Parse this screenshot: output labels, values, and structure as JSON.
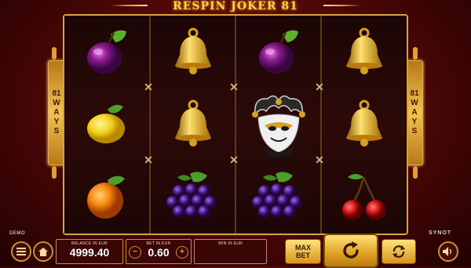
{
  "game": {
    "title": "RESPIN JOKER 81",
    "ways_number": "81",
    "ways_letters": [
      "W",
      "A",
      "Y",
      "S"
    ],
    "demo_label": "DEMO",
    "provider": "SYNOT"
  },
  "reels": [
    [
      "plum",
      "lemon",
      "orange"
    ],
    [
      "bell",
      "bell",
      "grapes"
    ],
    [
      "plum",
      "joker",
      "grapes"
    ],
    [
      "bell",
      "bell",
      "cherries"
    ]
  ],
  "hud": {
    "balance_label": "BALANCE IN EUR",
    "balance_value": "4999.40",
    "bet_label": "BET IN EUR",
    "bet_value": "0.60",
    "minus": "−",
    "plus": "+",
    "win_label": "WIN IN EUR",
    "win_value": "",
    "maxbet_line1": "MAX",
    "maxbet_line2": "BET"
  },
  "icons": {
    "menu": "menu-icon",
    "home": "home-icon",
    "spin": "spin-icon",
    "autoplay": "autoplay-icon",
    "sound": "speaker-icon"
  },
  "colors": {
    "gold": "#d8a43a",
    "background": "#4a0606",
    "reel_bg": "#2c0a08"
  }
}
